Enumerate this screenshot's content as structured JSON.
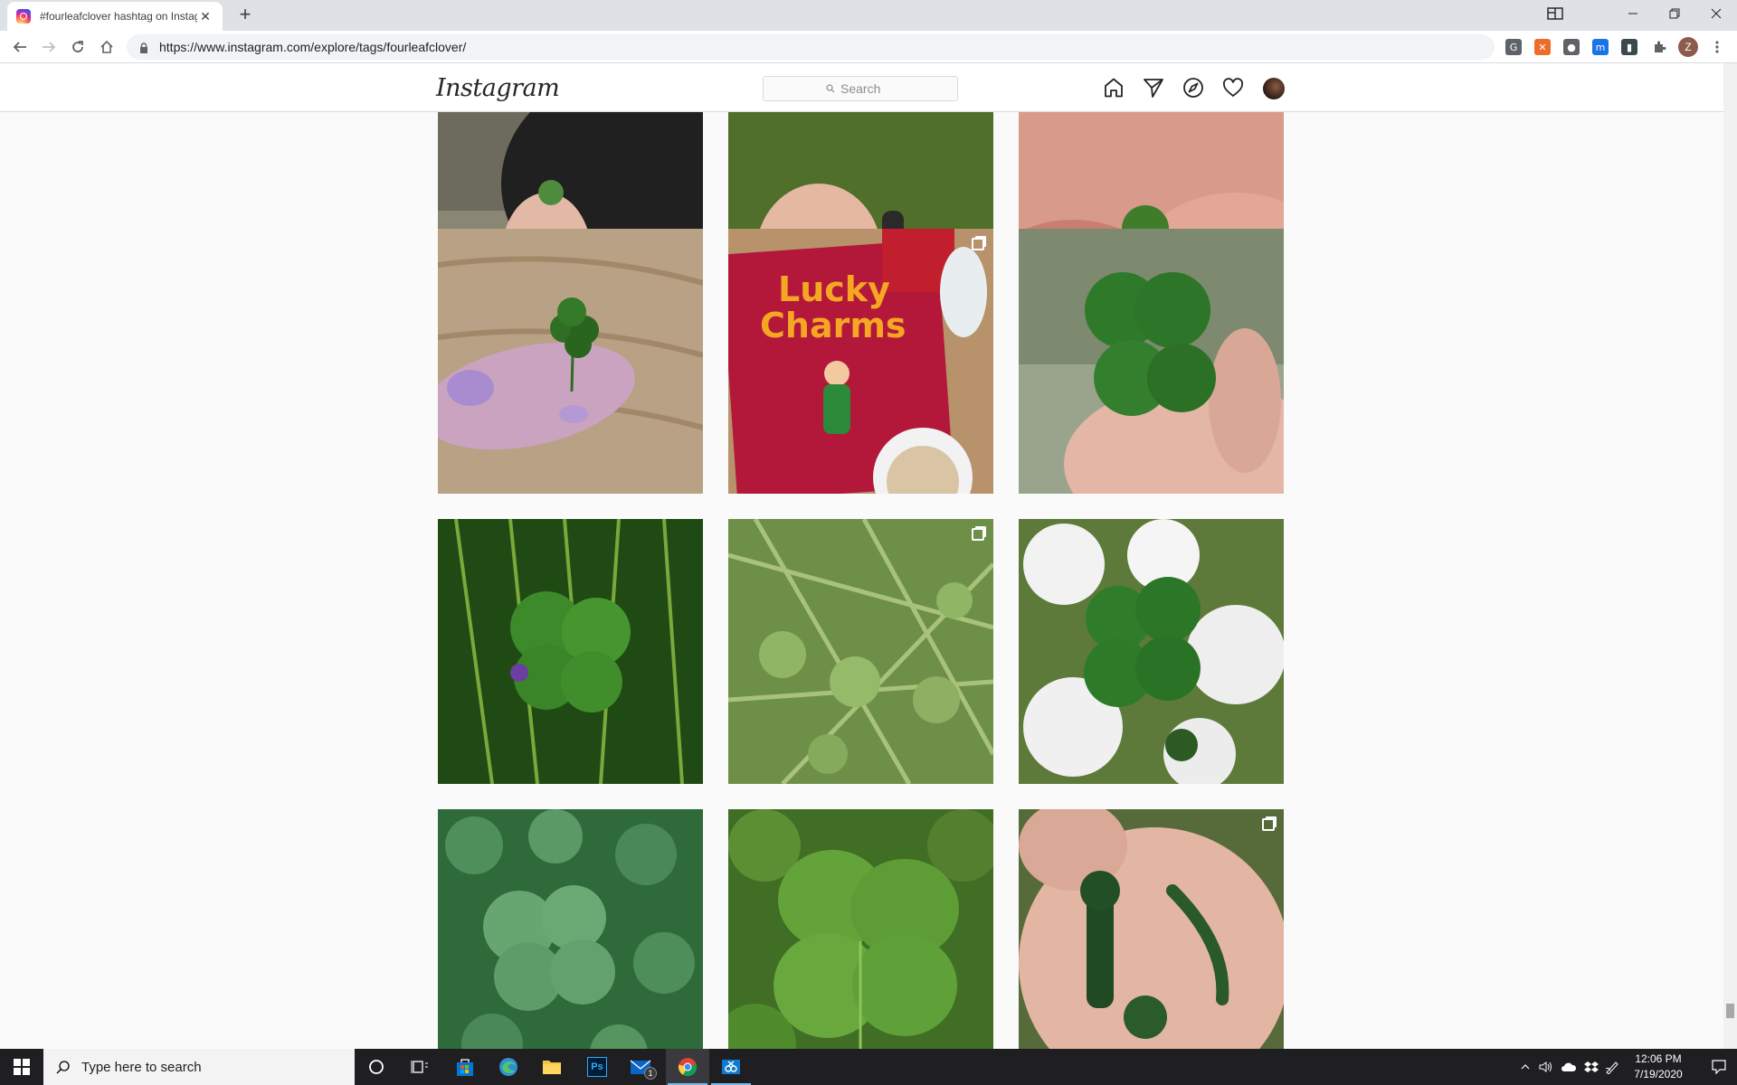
{
  "browser": {
    "tab_title": "#fourleafclover hashtag on Instag",
    "tab_close": "✕",
    "new_tab": "+",
    "url": "https://www.instagram.com/explore/tags/fourleafclover/",
    "profile_initial": "Z",
    "extensions": [
      {
        "icon": "g-extension-icon",
        "glyph": "G",
        "color": "#5f6368"
      },
      {
        "icon": "orange-extension-icon",
        "glyph": "✕",
        "color": "#ee6c2b"
      },
      {
        "icon": "circle-extension-icon",
        "glyph": "●",
        "color": "#5f6368"
      },
      {
        "icon": "blue-extension-icon",
        "glyph": "m",
        "color": "#1a73e8"
      },
      {
        "icon": "dark-extension-icon",
        "glyph": "▮",
        "color": "#3c4a4e"
      }
    ]
  },
  "instagram": {
    "logo": "Instagram",
    "search_placeholder": "Search",
    "nav_icons": [
      "home-icon",
      "direct-message-icon",
      "explore-icon",
      "activity-heart-icon",
      "profile-avatar"
    ]
  },
  "posts": [
    {
      "row": 0,
      "col": 0,
      "kind": "hand-tire",
      "multi": false
    },
    {
      "row": 0,
      "col": 1,
      "kind": "hand-grass",
      "multi": false
    },
    {
      "row": 0,
      "col": 2,
      "kind": "fingers",
      "multi": false
    },
    {
      "row": 1,
      "col": 0,
      "kind": "purple-nails-clover",
      "multi": false
    },
    {
      "row": 1,
      "col": 1,
      "kind": "lucky-charms-shirt",
      "multi": true,
      "text_line1": "Lucky",
      "text_line2": "Charms"
    },
    {
      "row": 1,
      "col": 2,
      "kind": "clover-fingers",
      "multi": false
    },
    {
      "row": 2,
      "col": 0,
      "kind": "clover-dark-grass",
      "multi": false
    },
    {
      "row": 2,
      "col": 1,
      "kind": "clover-patch",
      "multi": true
    },
    {
      "row": 2,
      "col": 2,
      "kind": "clover-white-flowers",
      "multi": false
    },
    {
      "row": 3,
      "col": 0,
      "kind": "clover-bed",
      "multi": false
    },
    {
      "row": 3,
      "col": 1,
      "kind": "big-clover-leaf",
      "multi": false
    },
    {
      "row": 3,
      "col": 2,
      "kind": "jade-charms",
      "multi": true
    }
  ],
  "taskbar": {
    "search_placeholder": "Type here to search",
    "mail_badge": "1",
    "time": "12:06 PM",
    "date": "7/19/2020"
  }
}
